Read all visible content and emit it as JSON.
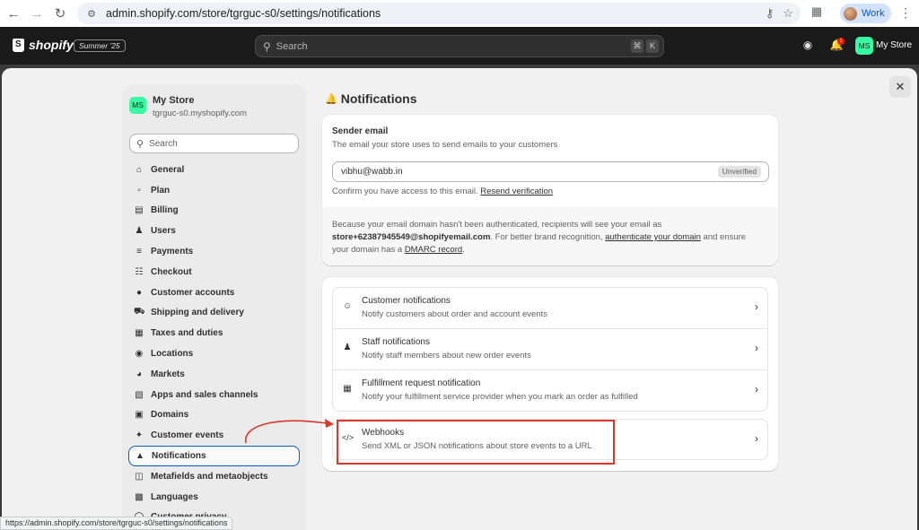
{
  "browser": {
    "url": "admin.shopify.com/store/tgrguc-s0/settings/notifications",
    "profile_label": "Work"
  },
  "topbar": {
    "logo_text": "shopify",
    "edition_badge": "Summer '25",
    "search_placeholder": "Search",
    "shortcut_keys": [
      "⌘",
      "K"
    ],
    "notification_count": "1",
    "store_initials": "MS",
    "store_name": "My Store"
  },
  "sidebar": {
    "store_initials": "MS",
    "store_name": "My Store",
    "store_domain": "tgrguc-s0.myshopify.com",
    "search_placeholder": "Search",
    "items": [
      {
        "label": "General",
        "icon": "store-icon"
      },
      {
        "label": "Plan",
        "icon": "plan-icon"
      },
      {
        "label": "Billing",
        "icon": "billing-icon"
      },
      {
        "label": "Users",
        "icon": "users-icon"
      },
      {
        "label": "Payments",
        "icon": "payments-icon"
      },
      {
        "label": "Checkout",
        "icon": "cart-icon"
      },
      {
        "label": "Customer accounts",
        "icon": "person-icon"
      },
      {
        "label": "Shipping and delivery",
        "icon": "truck-icon"
      },
      {
        "label": "Taxes and duties",
        "icon": "tax-icon"
      },
      {
        "label": "Locations",
        "icon": "location-icon"
      },
      {
        "label": "Markets",
        "icon": "globe-icon"
      },
      {
        "label": "Apps and sales channels",
        "icon": "apps-icon"
      },
      {
        "label": "Domains",
        "icon": "domain-icon"
      },
      {
        "label": "Customer events",
        "icon": "sparkle-icon"
      },
      {
        "label": "Notifications",
        "icon": "bell-icon",
        "active": true
      },
      {
        "label": "Metafields and metaobjects",
        "icon": "metafields-icon"
      },
      {
        "label": "Languages",
        "icon": "language-icon"
      },
      {
        "label": "Customer privacy",
        "icon": "privacy-icon"
      }
    ]
  },
  "main": {
    "title": "Notifications",
    "sender": {
      "label": "Sender email",
      "help": "The email your store uses to send emails to your customers",
      "email": "vibhu@wabb.in",
      "status": "Unverified",
      "confirm_text": "Confirm you have access to this email.",
      "resend_link": "Resend verification",
      "note_1": "Because your email domain hasn't been authenticated, recipients will see your email as",
      "note_email": "store+62387945549@shopifyemail.com",
      "note_2": ". For better brand recognition,",
      "note_link_1": "authenticate your domain",
      "note_3": "and ensure",
      "note_4": "your domain has a",
      "note_link_2": "DMARC record",
      "note_5": "."
    },
    "rows": [
      {
        "title": "Customer notifications",
        "subtitle": "Notify customers about order and account events",
        "icon": "person-icon"
      },
      {
        "title": "Staff notifications",
        "subtitle": "Notify staff members about new order events",
        "icon": "staff-icon"
      },
      {
        "title": "Fulfillment request notification",
        "subtitle": "Notify your fulfillment service provider when you mark an order as fulfilled",
        "icon": "calendar-icon"
      },
      {
        "title": "Webhooks",
        "subtitle": "Send XML or JSON notifications about store events to a URL",
        "icon": "code-icon"
      }
    ]
  },
  "status_bar": "https://admin.shopify.com/store/tgrguc-s0/settings/notifications",
  "colors": {
    "accent_blue": "#005bd3",
    "store_badge": "#36fba1",
    "annotation_red": "#d9382b"
  }
}
